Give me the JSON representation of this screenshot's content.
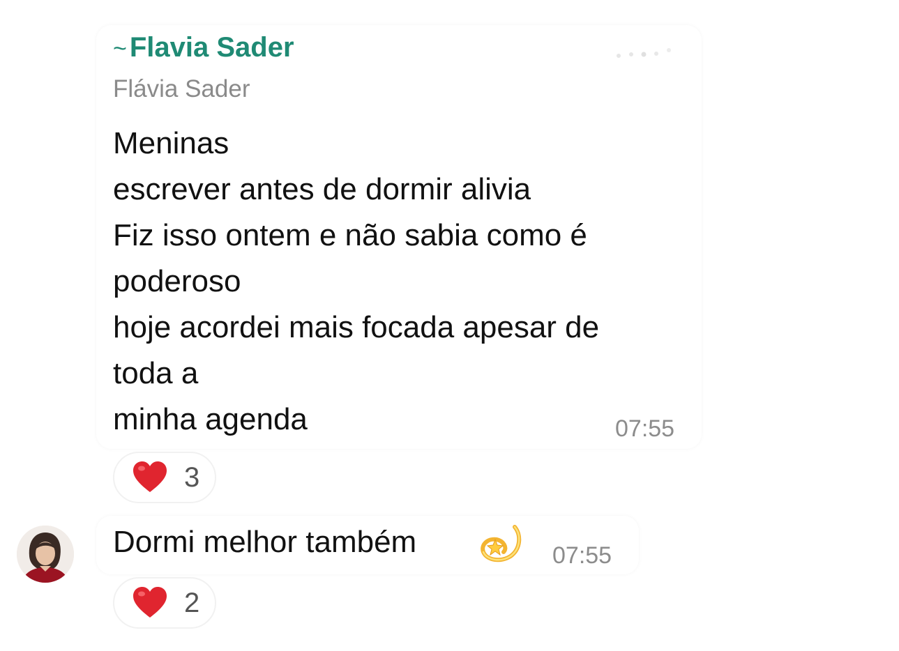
{
  "messages": [
    {
      "sender_display": "Flavia Sader",
      "sender_prefix": "~",
      "sender_name": "Flávia Sader",
      "lines": [
        "Meninas",
        "escrever antes de dormir alivia",
        "Fiz isso ontem e não sabia como é",
        "poderoso",
        "hoje acordei mais focada apesar de",
        "toda a",
        "minha agenda"
      ],
      "time": "07:55",
      "reaction": {
        "emoji": "heart-icon",
        "count": "3"
      }
    },
    {
      "text": "Dormi melhor também",
      "emoji": "dizzy-icon",
      "time": "07:55",
      "reaction": {
        "emoji": "heart-icon",
        "count": "2"
      }
    }
  ],
  "colors": {
    "sender": "#1f8a74",
    "heart": "#e0252f",
    "timestamp": "#8c8c8c"
  }
}
